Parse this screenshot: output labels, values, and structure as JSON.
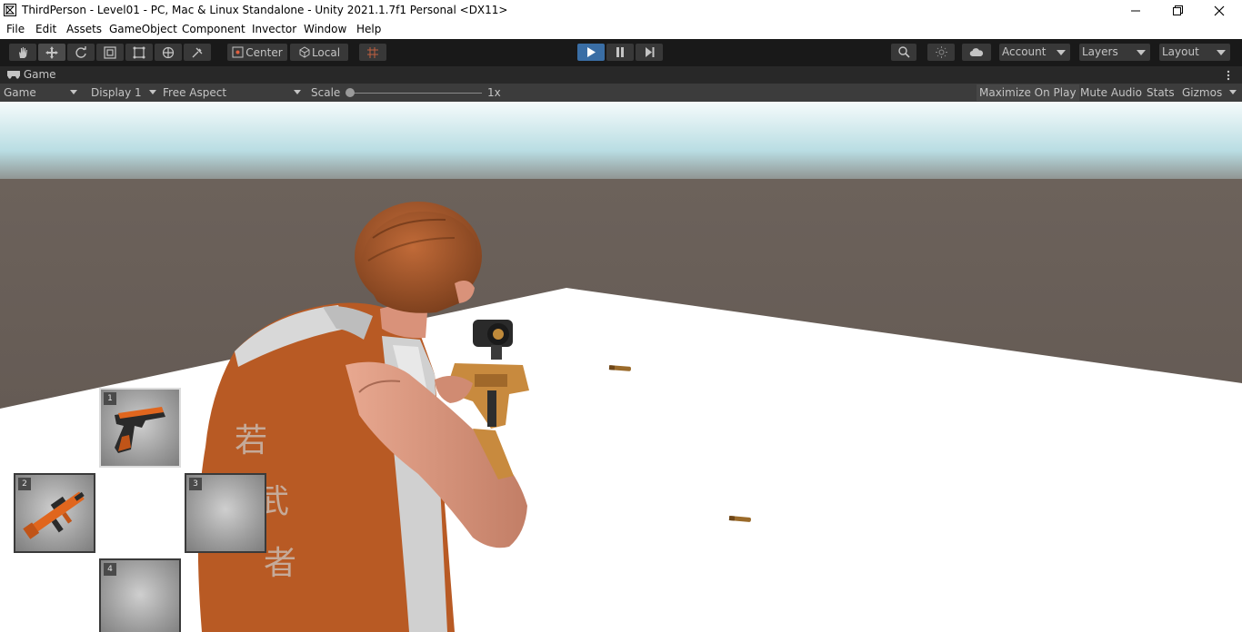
{
  "window": {
    "title": "ThirdPerson - Level01 - PC, Mac & Linux Standalone - Unity 2021.1.7f1 Personal <DX11>"
  },
  "menu": [
    "File",
    "Edit",
    "Assets",
    "GameObject",
    "Component",
    "Invector",
    "Window",
    "Help"
  ],
  "toolbar": {
    "pivot_label": "Center",
    "space_label": "Local",
    "account_label": "Account",
    "layers_label": "Layers",
    "layout_label": "Layout"
  },
  "game_tab": {
    "label": "Game"
  },
  "game_bar": {
    "view_mode": "Game",
    "display": "Display 1",
    "aspect": "Free Aspect",
    "scale_label": "Scale",
    "scale_value": "1x",
    "maximize_label": "Maximize On Play",
    "mute_label": "Mute Audio",
    "stats_label": "Stats",
    "gizmos_label": "Gizmos"
  },
  "inventory": {
    "slots": [
      {
        "number": "1",
        "item": "pistol"
      },
      {
        "number": "2",
        "item": "assault-rifle"
      },
      {
        "number": "3",
        "item": ""
      },
      {
        "number": "4",
        "item": ""
      }
    ]
  },
  "character": {
    "shirt_text": [
      "若",
      "武",
      "者"
    ]
  },
  "colors": {
    "toolbar_bg": "#191919",
    "panel_bg": "#3c3c3c",
    "play_active": "#3a6ea5",
    "sky_top": "#f5fbfb",
    "sky_horizon": "#a8d4dc",
    "ground": "#6a5f58",
    "floor": "#ffffff",
    "shirt": "#b85a24"
  }
}
